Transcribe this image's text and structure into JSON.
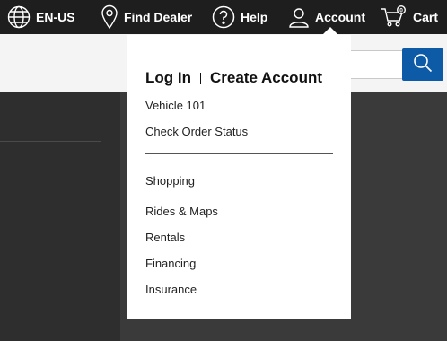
{
  "topbar": {
    "locale": {
      "label": "EN-US",
      "icon": "globe-icon"
    },
    "dealer": {
      "label": "Find Dealer",
      "icon": "map-pin-icon"
    },
    "help": {
      "label": "Help",
      "icon": "question-circle-icon"
    },
    "account": {
      "label": "Account",
      "icon": "user-icon"
    },
    "cart": {
      "label": "Cart",
      "icon": "cart-icon",
      "count": "0"
    }
  },
  "search": {
    "placeholder": "",
    "icon": "search-icon"
  },
  "account_menu": {
    "login_label": "Log In",
    "create_label": "Create Account",
    "items_top": [
      "Vehicle 101",
      "Check Order Status"
    ],
    "items_bottom": [
      "Shopping",
      "Rides & Maps",
      "Rentals",
      "Financing",
      "Insurance"
    ]
  },
  "colors": {
    "topbar_bg": "#1e1e1e",
    "search_button": "#0d5ba6",
    "page_bg": "#333333",
    "menu_bg": "#ffffff"
  }
}
